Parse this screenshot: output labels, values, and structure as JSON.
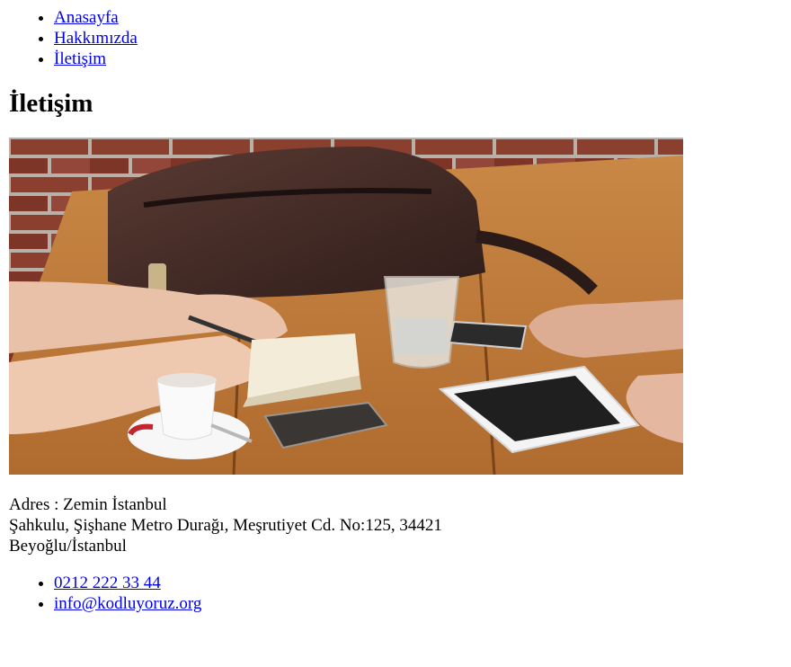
{
  "nav": {
    "items": [
      {
        "label": "Anasayfa"
      },
      {
        "label": "Hakkımızda"
      },
      {
        "label": "İletişim"
      }
    ]
  },
  "page": {
    "title": "İletişim"
  },
  "photo": {
    "alt": "Masa başında toplantı: çanta, defter, bardak su, telefon ve tablet"
  },
  "address": {
    "line1": "Adres : Zemin İstanbul",
    "line2": "Şahkulu, Şişhane Metro Durağı, Meşrutiyet Cd. No:125, 34421",
    "line3": "Beyoğlu/İstanbul"
  },
  "contacts": {
    "items": [
      {
        "label": "0212 222 33 44"
      },
      {
        "label": "info@kodluyoruz.org"
      }
    ]
  }
}
